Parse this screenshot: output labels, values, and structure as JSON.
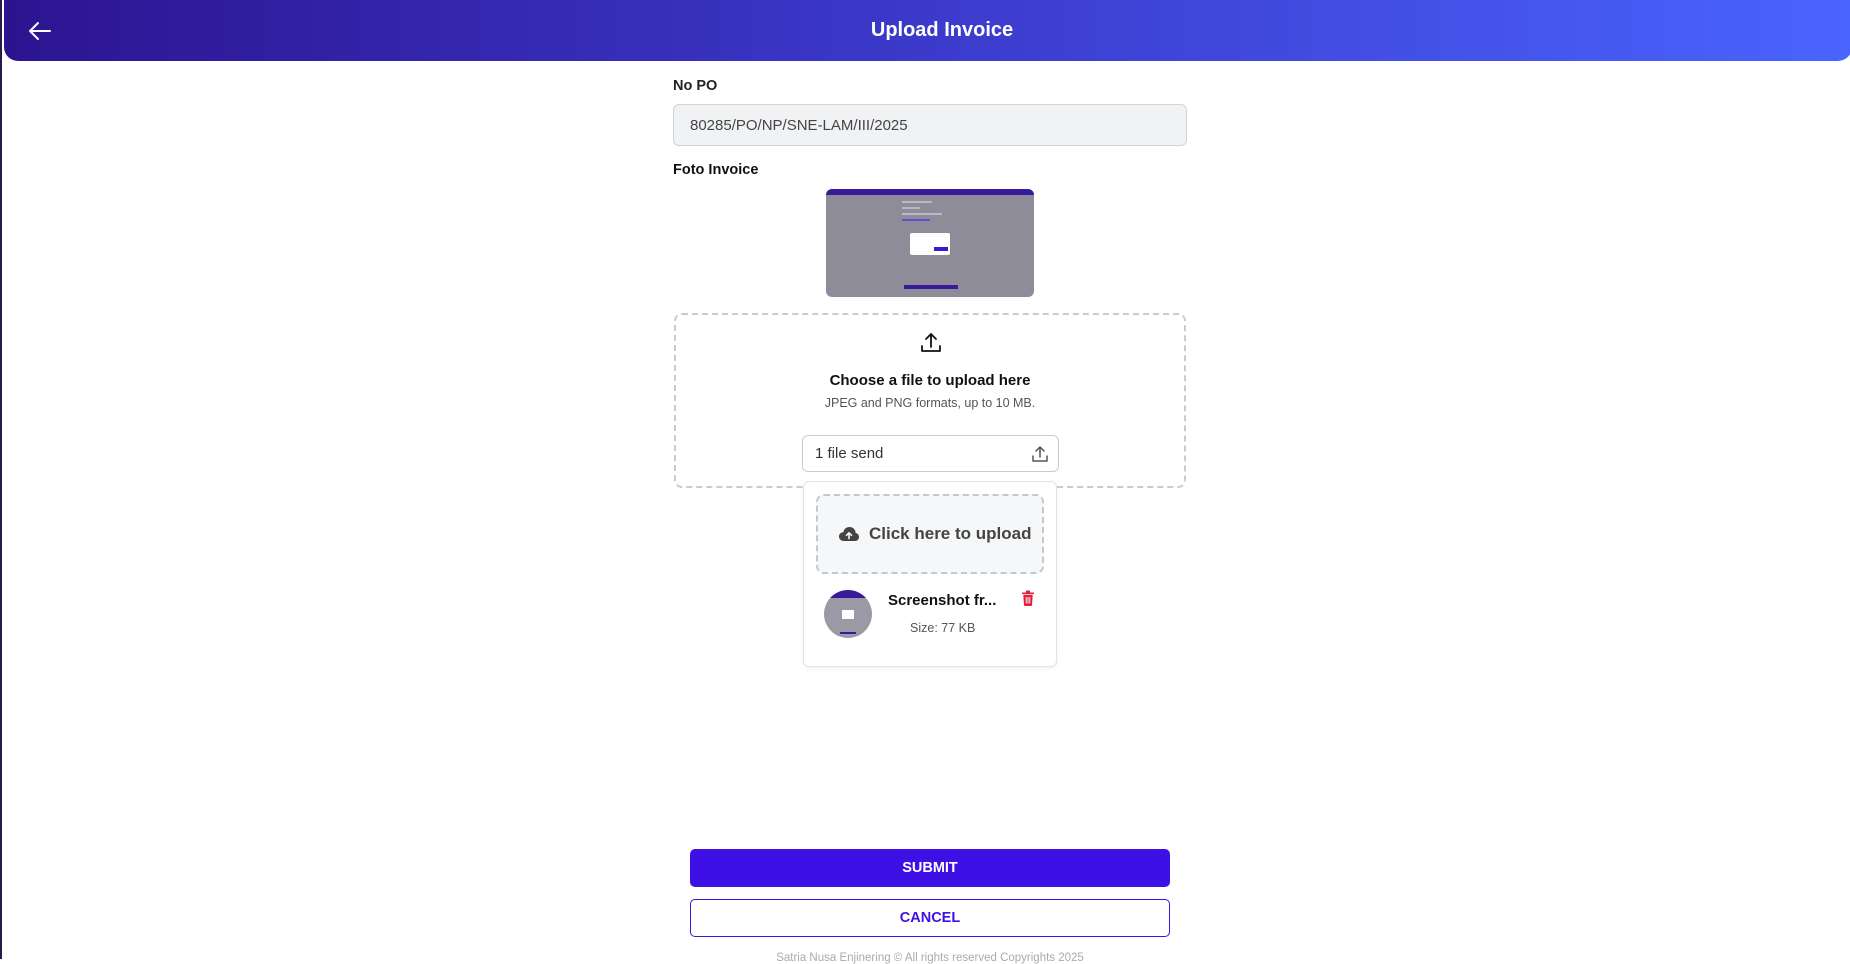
{
  "header": {
    "title": "Upload Invoice"
  },
  "form": {
    "po_label": "No PO",
    "po_value": "80285/PO/NP/SNE-LAM/III/2025",
    "photo_label": "Foto Invoice"
  },
  "dropzone": {
    "title": "Choose a file to upload here",
    "subtitle": "JPEG and PNG formats, up to 10 MB.",
    "file_input_text": "1 file send"
  },
  "upload_popup": {
    "click_label": "Click here to upload",
    "file_name": "Screenshot fr...",
    "file_size": "Size: 77 KB"
  },
  "actions": {
    "submit_label": "SUBMIT",
    "cancel_label": "CANCEL"
  },
  "footer": {
    "text": "Satria Nusa Enjinering © All rights reserved Copyrights 2025"
  },
  "colors": {
    "primary": "#3e10e6",
    "header_start": "#2c1490",
    "header_end": "#4a64ff",
    "danger": "#e01e37"
  },
  "icons": [
    "arrow-left-icon",
    "upload-icon",
    "cloud-upload-icon",
    "trash-icon"
  ]
}
